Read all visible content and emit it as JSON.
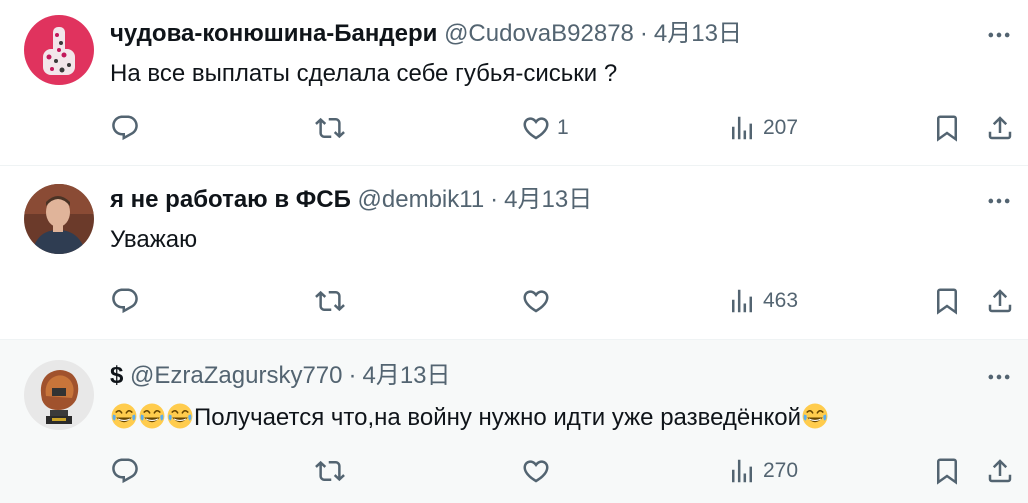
{
  "colors": {
    "text": "#0f1419",
    "muted": "#536471",
    "divider": "#eff3f4",
    "highlight_bg": "#f7f9f9"
  },
  "tweets": [
    {
      "name": "чудова-конюшина-Бандери",
      "handle": "@CudovaB92878",
      "sep": "·",
      "date": "4月13日",
      "text": "На все выплаты сделала себе губья-сиськи ?",
      "likes": "1",
      "views": "207",
      "avatar": "pink-floral-hand-avatar"
    },
    {
      "name": "я не работаю в ФСБ",
      "handle": "@dembik11",
      "sep": "·",
      "date": "4月13日",
      "text": "Уважаю",
      "likes": "",
      "views": "463",
      "avatar": "man-photo-avatar"
    },
    {
      "name": "$",
      "handle": "@EzraZagursky770",
      "sep": "·",
      "date": "4月13日",
      "text_prefix_emojis": "🤣🤣🤣",
      "text": "Получается что,на войну нужно идти уже разведёнкой",
      "text_suffix_emoji": "🤣",
      "likes": "",
      "views": "270",
      "avatar": "bronze-trophy-avatar"
    }
  ],
  "icons": {
    "reply": "reply-icon",
    "retweet": "retweet-icon",
    "like": "heart-icon",
    "views": "views-chart-icon",
    "bookmark": "bookmark-icon",
    "share": "share-icon",
    "more": "more-dots-icon",
    "emoji": "rolling-laughing-emoji"
  }
}
